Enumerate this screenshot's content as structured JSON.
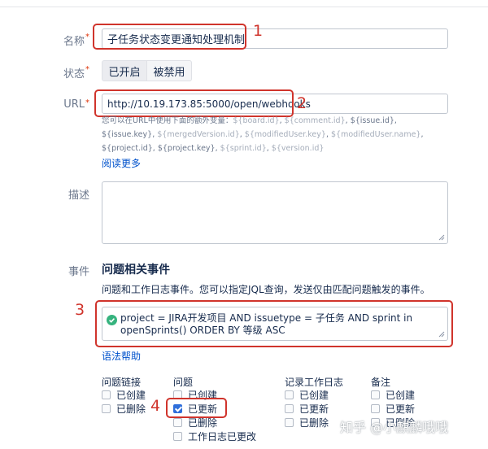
{
  "form": {
    "name_label": "名称",
    "name_value": "子任务状态变更通知处理机制",
    "status_label": "状态",
    "status_enabled": "已开启",
    "status_disabled": "被禁用",
    "url_label": "URL",
    "url_value": "http://10.19.173.85:5000/open/webhooks",
    "url_hint_lines": [
      [
        "您可以在URL中使用下面的额外变量：",
        "${board.id}",
        ", ",
        "${comment.id}",
        ", ",
        "${issue.id}",
        ","
      ],
      [
        "${issue.key}",
        ", ",
        "${mergedVersion.id}",
        ", ",
        "${modifiedUser.key}",
        ", ",
        "${modifiedUser.name}",
        ","
      ],
      [
        "${project.id}",
        ", ",
        "${project.key}",
        ", ",
        "${sprint.id}",
        ", ",
        "${version.id}",
        ""
      ]
    ],
    "read_more": "阅读更多",
    "desc_label": "描述",
    "events_label": "事件",
    "events_title": "问题相关事件",
    "events_sub": "问题和工作日志事件。您可以指定JQL查询，发送仅由匹配问题触发的事件。",
    "jql_line1": "project = JIRA开发项目 AND issuetype = 子任务 AND sprint in",
    "jql_line2": "openSprints()  ORDER BY  等级 ASC",
    "syntax_help": "语法帮助",
    "columns": [
      {
        "title": "问题链接",
        "items": [
          {
            "label": "已创建",
            "checked": false
          },
          {
            "label": "已删除",
            "checked": false
          }
        ]
      },
      {
        "title": "问题",
        "items": [
          {
            "label": "已创建",
            "checked": false
          },
          {
            "label": "已更新",
            "checked": true
          },
          {
            "label": "已删除",
            "checked": false
          },
          {
            "label": "工作日志已更改",
            "checked": false
          }
        ]
      },
      {
        "title": "记录工作日志",
        "items": [
          {
            "label": "已创建",
            "checked": false
          },
          {
            "label": "已更新",
            "checked": false
          },
          {
            "label": "已删除",
            "checked": false
          }
        ]
      },
      {
        "title": "备注",
        "items": [
          {
            "label": "已创建",
            "checked": false
          },
          {
            "label": "已更新",
            "checked": false
          },
          {
            "label": "已删除",
            "checked": false
          }
        ]
      }
    ]
  },
  "annotations": {
    "n1": "1",
    "n2": "2",
    "n3": "3",
    "n4": "4"
  },
  "watermark": "知乎 @小麒麟哦哦",
  "colors": {
    "accent": "#0052cc",
    "highlight": "#d0342c",
    "success": "#36b37e",
    "checkbox": "#2f6fdb"
  }
}
